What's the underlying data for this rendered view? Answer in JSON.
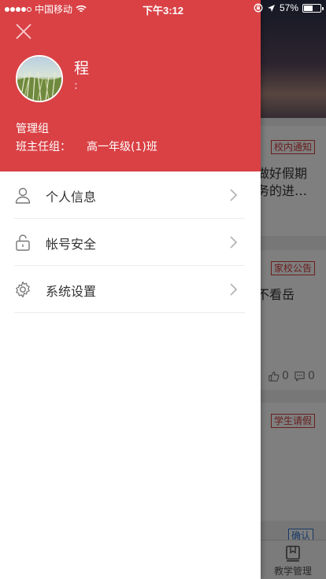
{
  "status_bar": {
    "carrier": "中国移动",
    "time": "下午3:12",
    "battery": "57%",
    "battery_level": 0.57
  },
  "drawer": {
    "user_name": "程",
    "user_sub": ":",
    "group_label": "管理组",
    "head_teacher_label": "班主任组：",
    "head_teacher_value": "高一年级(1)班",
    "menu": [
      {
        "label": "个人信息",
        "icon": "person-icon"
      },
      {
        "label": "帐号安全",
        "icon": "lock-icon"
      },
      {
        "label": "系统设置",
        "icon": "gear-icon"
      }
    ]
  },
  "background": {
    "cards": [
      {
        "tag": "校内通知",
        "lines": [
          "做好假期",
          "务的进…"
        ]
      },
      {
        "tag": "家校公告",
        "lines": [
          "不看岳"
        ],
        "likes": "0",
        "comments": "0"
      },
      {
        "tag": "学生请假",
        "lines": []
      }
    ],
    "confirm_tag": "确认",
    "tab_label": "教学管理"
  },
  "colors": {
    "header_red": "#d94145",
    "tag_red": "#d23c3c",
    "confirm_blue": "#2a6fc9"
  }
}
